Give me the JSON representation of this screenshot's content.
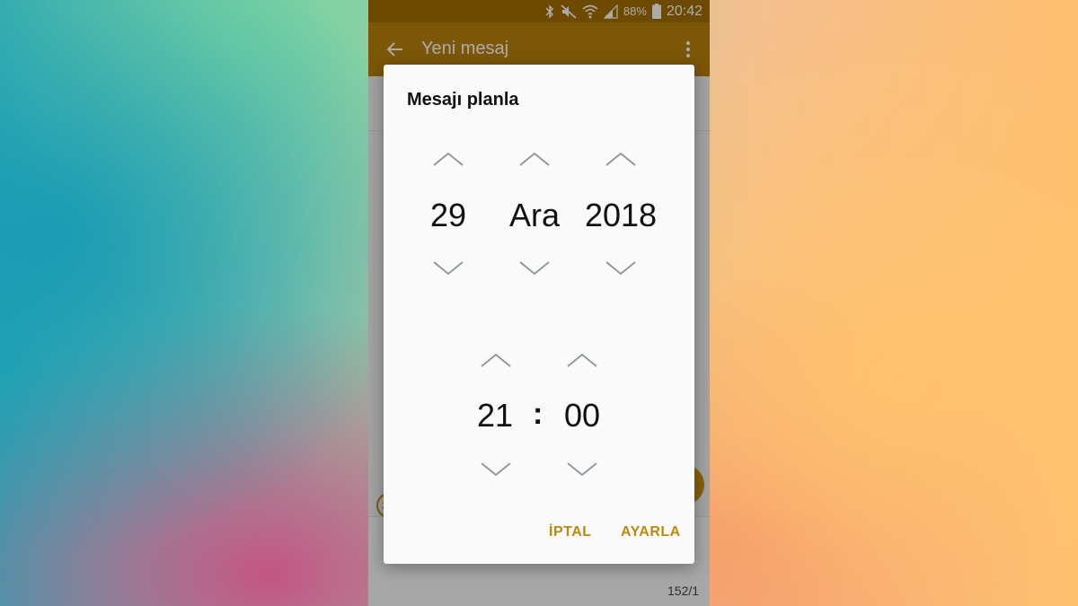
{
  "status_bar": {
    "battery_percent": "88%",
    "time": "20:42",
    "icons": [
      "bluetooth-icon",
      "mute-icon",
      "wifi-icon",
      "signal-icon",
      "battery-icon"
    ]
  },
  "app_bar": {
    "title": "Yeni mesaj"
  },
  "compose": {
    "char_counter": "152/1"
  },
  "dialog": {
    "title": "Mesajı planla",
    "date": {
      "day": "29",
      "month": "Ara",
      "year": "2018"
    },
    "time": {
      "hour": "21",
      "separator": ":",
      "minute": "00"
    },
    "buttons": {
      "cancel": "İPTAL",
      "set": "AYARLA"
    }
  },
  "colors": {
    "status_bar": "#a46f00",
    "app_bar": "#b9820c",
    "accent": "#b88a10",
    "chevron": "#8a9499"
  }
}
